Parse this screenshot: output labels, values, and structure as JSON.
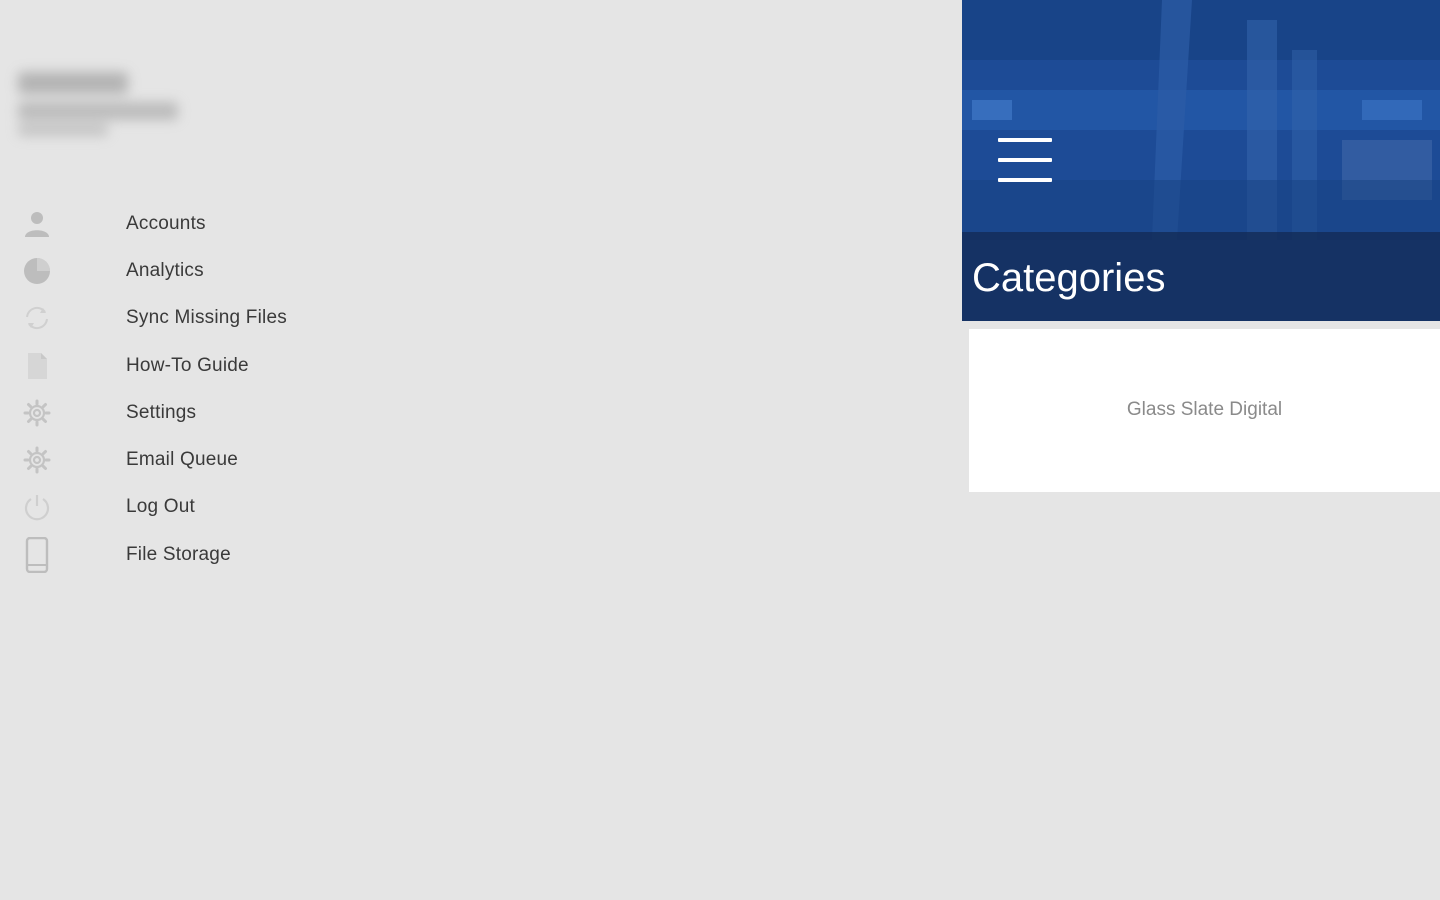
{
  "menu": {
    "items": [
      {
        "label": "Accounts",
        "icon": "person-icon"
      },
      {
        "label": "Analytics",
        "icon": "pie-chart-icon"
      },
      {
        "label": "Sync Missing Files",
        "icon": "sync-icon"
      },
      {
        "label": "How-To Guide",
        "icon": "document-icon"
      },
      {
        "label": "Settings",
        "icon": "gear-icon"
      },
      {
        "label": "Email Queue",
        "icon": "gear-icon"
      },
      {
        "label": "Log Out",
        "icon": "power-icon"
      },
      {
        "label": "File Storage",
        "icon": "phone-icon"
      }
    ]
  },
  "header": {
    "title": "Categories",
    "menu_icon": "hamburger-menu-icon"
  },
  "categories": [
    {
      "label": "Glass Slate Digital"
    }
  ],
  "colors": {
    "background": "#e5e5e5",
    "header_blue": "#1f4e9a",
    "icon_gray": "#bdbdbd",
    "text_dark": "#3a3a3a",
    "card_text": "#8a8a8a"
  }
}
